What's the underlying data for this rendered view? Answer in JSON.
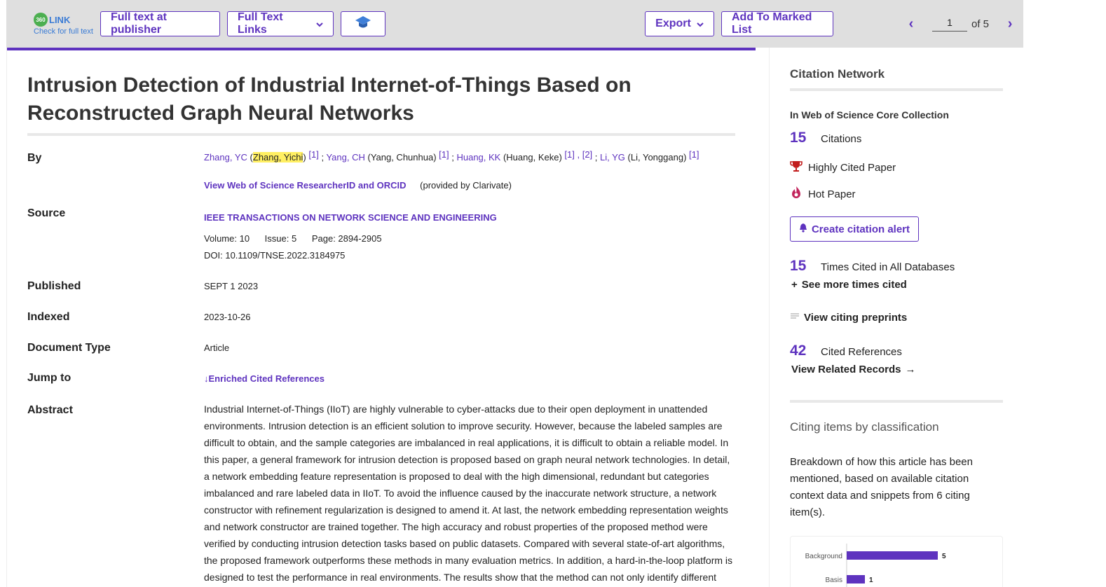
{
  "toolbar": {
    "link360_logo_text": "360",
    "link360_label": "LINK",
    "link360_sub": "Check for full text",
    "full_text_publisher": "Full text at publisher",
    "full_text_links": "Full Text Links",
    "export": "Export",
    "add_marked": "Add To Marked List",
    "page_current": "1",
    "page_of": "of 5"
  },
  "record": {
    "title": "Intrusion Detection of Industrial Internet-of-Things Based on Reconstructed Graph Neural Networks",
    "labels": {
      "by": "By",
      "source": "Source",
      "published": "Published",
      "indexed": "Indexed",
      "doctype": "Document Type",
      "jump": "Jump to",
      "abstract": "Abstract"
    },
    "authors": [
      {
        "short": "Zhang, YC",
        "full": "Zhang, Yichi",
        "refs": "[1]"
      },
      {
        "short": "Yang, CH",
        "full": "Yang, Chunhua",
        "refs": "[1]"
      },
      {
        "short": "Huang, KK",
        "full": "Huang, Keke",
        "refs": "[1] , [2]"
      },
      {
        "short": "Li, YG",
        "full": "Li, Yonggang",
        "refs": "[1]"
      }
    ],
    "researcher_link": "View Web of Science ResearcherID and ORCID",
    "provided_by": "(provided by Clarivate)",
    "journal": "IEEE TRANSACTIONS ON NETWORK SCIENCE AND ENGINEERING",
    "volume": "Volume: 10",
    "issue": "Issue: 5",
    "page": "Page: 2894-2905",
    "doi": "DOI: 10.1109/TNSE.2022.3184975",
    "published": "SEPT 1 2023",
    "indexed": "2023-10-26",
    "doctype": "Article",
    "jump_link": "Enriched Cited References",
    "abstract": "Industrial Internet-of-Things (IIoT) are highly vulnerable to cyber-attacks due to their open deployment in unattended environments. Intrusion detection is an efficient solution to improve security. However, because the labeled samples are difficult to obtain, and the sample categories are imbalanced in real applications, it is difficult to obtain a reliable model. In this paper, a general framework for intrusion detection is proposed based on graph neural network technologies. In detail, a network embedding feature representation is proposed to deal with the high dimensional, redundant but categories imbalanced and rare labeled data in IIoT. To avoid the influence caused by the inaccurate network structure, a network constructor with refinement regularization is designed to amend it. At last, the network embedding representation weights and network constructor are trained together. The high accuracy and robust properties of the proposed method were verified by conducting intrusion detection tasks based on public datasets. Compared with several state-of-art algorithms, the proposed framework outperforms these methods in many evaluation metrics. In addition, a hard-in-the-loop platform is designed to test the performance in real environments. The results show that the method can not only identify different attacks but also distinguish between cyber-attacks and physical"
  },
  "sidebar": {
    "heading": "Citation Network",
    "collection": "In Web of Science Core Collection",
    "citations_n": "15",
    "citations_t": "Citations",
    "highly_cited": "Highly Cited Paper",
    "hot_paper": "Hot Paper",
    "create_alert": "Create citation alert",
    "times_cited_n": "15",
    "times_cited_t": "Times Cited in All Databases",
    "see_more": "See more times cited",
    "citing_preprints": "View citing preprints",
    "cited_refs_n": "42",
    "cited_refs_t": "Cited References",
    "related": "View Related Records",
    "classification_heading": "Citing items by classification",
    "classification_desc": "Breakdown of how this article has been mentioned, based on available citation context data and snippets from 6 citing item(s)."
  },
  "chart_data": {
    "type": "bar",
    "orientation": "horizontal",
    "categories": [
      "Background",
      "Basis"
    ],
    "values": [
      5,
      1
    ],
    "color": "#5e33bf"
  },
  "colors": {
    "accent": "#5e33bf",
    "highlight": "#ffef62",
    "toolbar_bg": "#dfdfdf"
  }
}
